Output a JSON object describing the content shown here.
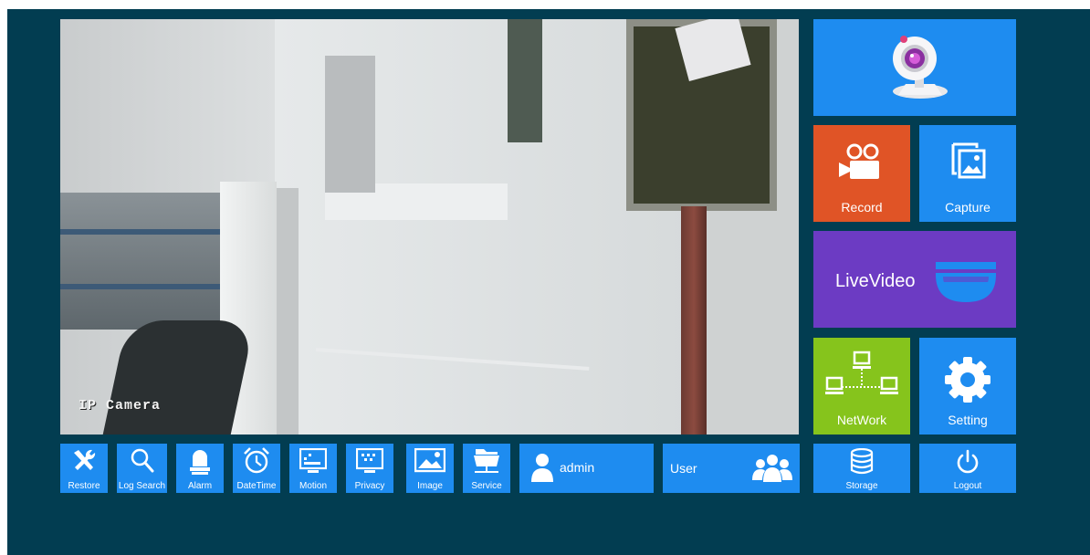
{
  "video": {
    "osd_text": "IP Camera"
  },
  "tiles": {
    "record": "Record",
    "capture": "Capture",
    "live_video": "LiveVideo",
    "network": "NetWork",
    "setting": "Setting",
    "storage": "Storage",
    "logout": "Logout"
  },
  "toolbar": {
    "restore": "Restore",
    "log_search": "Log Search",
    "alarm": "Alarm",
    "datetime": "DateTime",
    "motion": "Motion",
    "privacy": "Privacy",
    "image": "Image",
    "service": "Service",
    "admin": "admin",
    "user": "User"
  },
  "icons": {
    "webcam": "webcam-icon",
    "record": "video-camera-icon",
    "capture": "photo-icon",
    "live_video": "dome-camera-icon",
    "network": "network-icon",
    "setting": "gear-icon",
    "storage": "database-icon",
    "logout": "power-icon"
  },
  "colors": {
    "background": "#023d51",
    "blue_tile": "#1e8cf0",
    "record_tile": "#e05426",
    "live_tile": "#6c3bc3",
    "network_tile": "#86c41c"
  }
}
